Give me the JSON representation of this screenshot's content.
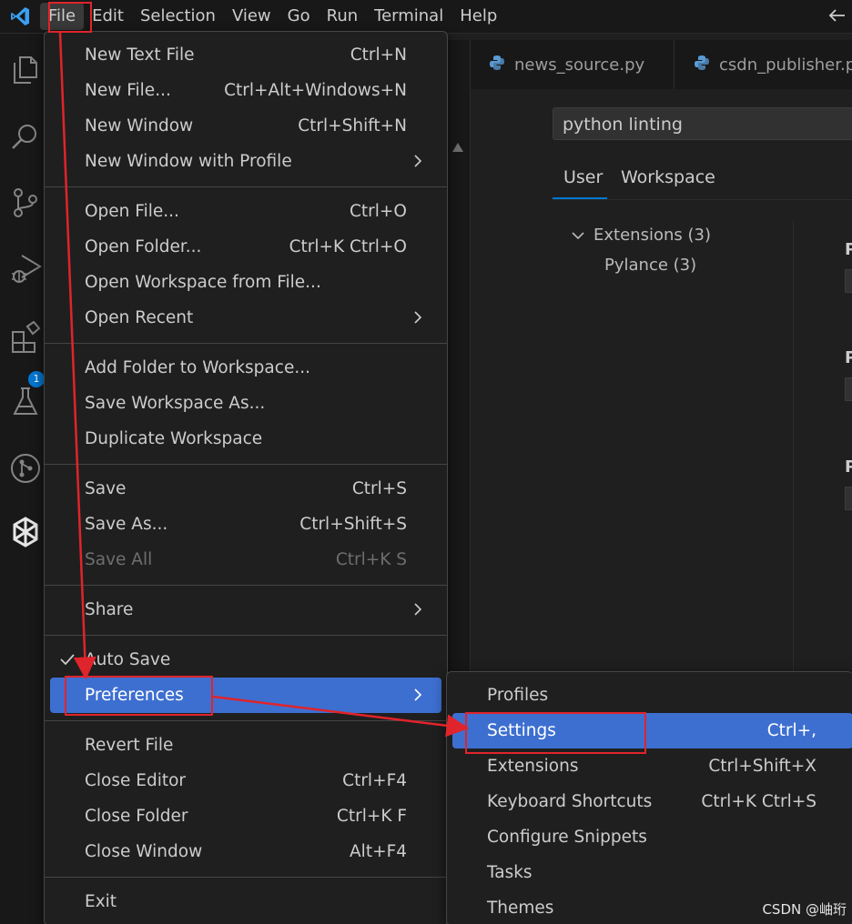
{
  "menubar": {
    "items": [
      "File",
      "Edit",
      "Selection",
      "View",
      "Go",
      "Run",
      "Terminal",
      "Help"
    ]
  },
  "activity_bar": {
    "extensions_badge": "1"
  },
  "tabs": [
    {
      "label": "news_source.py"
    },
    {
      "label": "csdn_publisher.py"
    }
  ],
  "settings": {
    "search_value": "python linting",
    "scope_tabs": [
      "User",
      "Workspace"
    ],
    "toc": [
      {
        "label": "Extensions (3)"
      },
      {
        "label": "Pylance (3)"
      }
    ],
    "partial_letters": [
      "P",
      "P",
      "P"
    ]
  },
  "file_menu": {
    "groups": [
      [
        {
          "label": "New Text File",
          "shortcut": "Ctrl+N"
        },
        {
          "label": "New File...",
          "shortcut": "Ctrl+Alt+Windows+N"
        },
        {
          "label": "New Window",
          "shortcut": "Ctrl+Shift+N"
        },
        {
          "label": "New Window with Profile",
          "shortcut": "",
          "submenu": true
        }
      ],
      [
        {
          "label": "Open File...",
          "shortcut": "Ctrl+O"
        },
        {
          "label": "Open Folder...",
          "shortcut": "Ctrl+K Ctrl+O"
        },
        {
          "label": "Open Workspace from File...",
          "shortcut": ""
        },
        {
          "label": "Open Recent",
          "shortcut": "",
          "submenu": true
        }
      ],
      [
        {
          "label": "Add Folder to Workspace...",
          "shortcut": ""
        },
        {
          "label": "Save Workspace As...",
          "shortcut": ""
        },
        {
          "label": "Duplicate Workspace",
          "shortcut": ""
        }
      ],
      [
        {
          "label": "Save",
          "shortcut": "Ctrl+S"
        },
        {
          "label": "Save As...",
          "shortcut": "Ctrl+Shift+S"
        },
        {
          "label": "Save All",
          "shortcut": "Ctrl+K S",
          "disabled": true
        }
      ],
      [
        {
          "label": "Share",
          "shortcut": "",
          "submenu": true
        }
      ],
      [
        {
          "label": "Auto Save",
          "shortcut": "",
          "checked": true
        },
        {
          "label": "Preferences",
          "shortcut": "",
          "submenu": true,
          "highlighted": true
        }
      ],
      [
        {
          "label": "Revert File",
          "shortcut": ""
        },
        {
          "label": "Close Editor",
          "shortcut": "Ctrl+F4"
        },
        {
          "label": "Close Folder",
          "shortcut": "Ctrl+K F"
        },
        {
          "label": "Close Window",
          "shortcut": "Alt+F4"
        }
      ],
      [
        {
          "label": "Exit",
          "shortcut": ""
        }
      ]
    ]
  },
  "preferences_menu": {
    "items": [
      {
        "label": "Profiles",
        "shortcut": ""
      },
      {
        "label": "Settings",
        "shortcut": "Ctrl+,",
        "highlighted": true
      },
      {
        "label": "Extensions",
        "shortcut": "Ctrl+Shift+X"
      },
      {
        "label": "Keyboard Shortcuts",
        "shortcut": "Ctrl+K Ctrl+S"
      },
      {
        "label": "Configure Snippets",
        "shortcut": ""
      },
      {
        "label": "Tasks",
        "shortcut": ""
      },
      {
        "label": "Themes",
        "shortcut": ""
      }
    ]
  },
  "colors": {
    "accent": "#3d6fd1",
    "annotation": "#e0242b",
    "background": "#1f1f1f"
  },
  "watermark": "CSDN @岫珩"
}
